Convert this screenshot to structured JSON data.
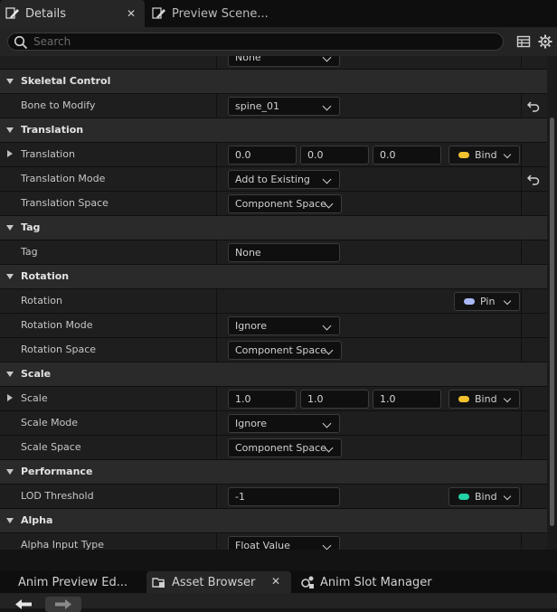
{
  "tabs": {
    "details": {
      "label": "Details",
      "close": "✕",
      "icon": "pencil-icon"
    },
    "preview": {
      "label": "Preview Scene...",
      "icon": "pencil-icon"
    }
  },
  "search": {
    "placeholder": "Search",
    "value": "",
    "icon": "search-icon"
  },
  "header_icons": [
    "table-view-icon",
    "settings-gear-icon"
  ],
  "partial_row": {
    "value": "None"
  },
  "rows": [
    {
      "type": "category",
      "label": "Skeletal Control"
    },
    {
      "type": "prop",
      "label": "Bone to Modify",
      "control": "dropdown",
      "value": "spine_01",
      "reset": true
    },
    {
      "type": "category",
      "label": "Translation"
    },
    {
      "type": "prop",
      "label": "Translation",
      "expandable": true,
      "control": "vector",
      "values": [
        "0.0",
        "0.0",
        "0.0"
      ],
      "pin": {
        "label": "Bind",
        "color": "#f2c12e"
      }
    },
    {
      "type": "prop",
      "label": "Translation Mode",
      "control": "dropdown",
      "value": "Add to Existing",
      "reset": true
    },
    {
      "type": "prop",
      "label": "Translation Space",
      "control": "dropdown",
      "value": "Component Space"
    },
    {
      "type": "category",
      "label": "Tag"
    },
    {
      "type": "prop",
      "label": "Tag",
      "control": "text",
      "value": "None"
    },
    {
      "type": "category",
      "label": "Rotation"
    },
    {
      "type": "prop",
      "label": "Rotation",
      "control": "none",
      "pin": {
        "label": "Pin",
        "color": "#a9b8f5"
      }
    },
    {
      "type": "prop",
      "label": "Rotation Mode",
      "control": "dropdown",
      "value": "Ignore"
    },
    {
      "type": "prop",
      "label": "Rotation Space",
      "control": "dropdown",
      "value": "Component Space"
    },
    {
      "type": "category",
      "label": "Scale"
    },
    {
      "type": "prop",
      "label": "Scale",
      "expandable": true,
      "control": "vector",
      "values": [
        "1.0",
        "1.0",
        "1.0"
      ],
      "pin": {
        "label": "Bind",
        "color": "#f2c12e"
      }
    },
    {
      "type": "prop",
      "label": "Scale Mode",
      "control": "dropdown",
      "value": "Ignore"
    },
    {
      "type": "prop",
      "label": "Scale Space",
      "control": "dropdown",
      "value": "Component Space"
    },
    {
      "type": "category",
      "label": "Performance"
    },
    {
      "type": "prop",
      "label": "LOD Threshold",
      "control": "text",
      "value": "-1",
      "pin": {
        "label": "Bind",
        "color": "#22d3a6"
      }
    },
    {
      "type": "category",
      "label": "Alpha"
    },
    {
      "type": "prop",
      "label": "Alpha Input Type",
      "control": "dropdown",
      "value": "Float Value"
    }
  ],
  "bottom_tabs": {
    "anim_preview": {
      "label": "Anim Preview Ed..."
    },
    "asset_browser": {
      "label": "Asset Browser",
      "close": "✕",
      "icon": "folder-icon"
    },
    "anim_slot": {
      "label": "Anim Slot Manager",
      "icon": "slot-manager-icon"
    }
  },
  "toolbar": {
    "icons": [
      "back-arrow-icon",
      "forward-arrow-icon"
    ]
  }
}
